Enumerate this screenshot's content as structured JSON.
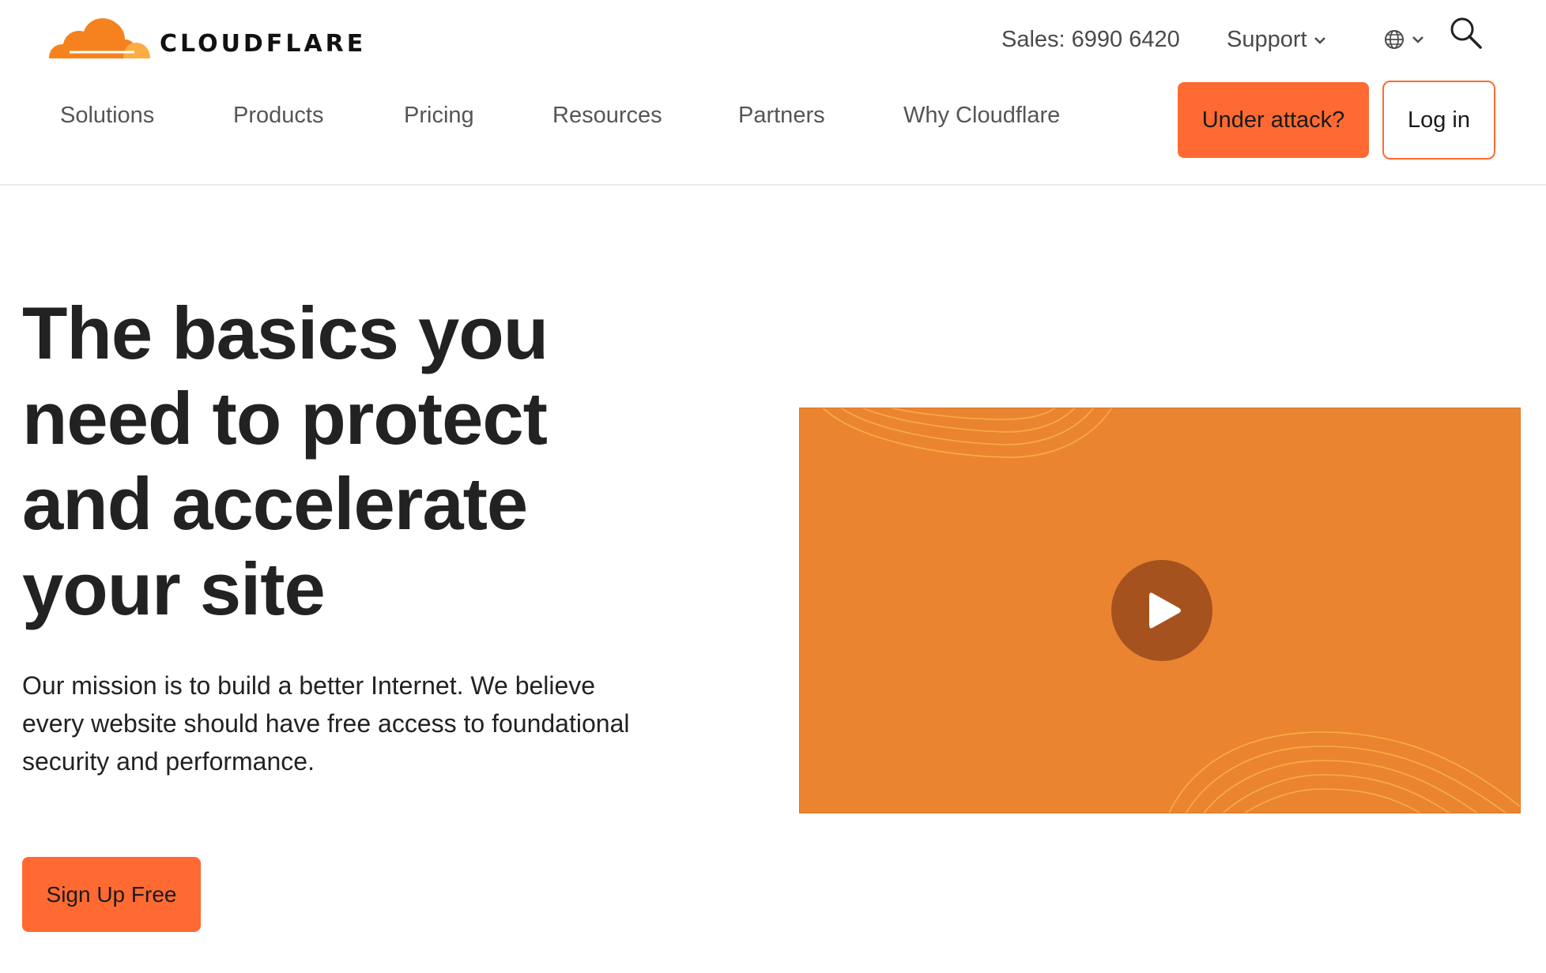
{
  "brand": {
    "name": "CLOUDFLARE",
    "accent_color": "#ff6a33",
    "video_color": "#eb8430"
  },
  "utility": {
    "sales": "Sales: 6990 6420",
    "support": "Support",
    "language_icon": "globe-icon",
    "search_icon": "search-icon"
  },
  "nav": {
    "items": [
      "Solutions",
      "Products",
      "Pricing",
      "Resources",
      "Partners",
      "Why Cloudflare"
    ],
    "under_attack": "Under attack?",
    "login": "Log in"
  },
  "hero": {
    "title": "The basics you need to protect and accelerate your site",
    "description": "Our mission is to build a better Internet. We believe every website should have free access to foundational security and performance.",
    "cta": "Sign Up Free",
    "video_icon": "play-icon"
  }
}
